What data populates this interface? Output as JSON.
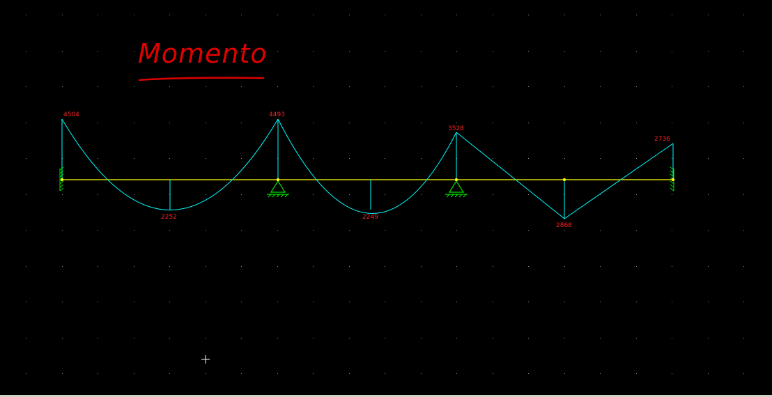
{
  "title": "Momento",
  "colors": {
    "background": "#000000",
    "beam": "#ffff00",
    "diagram": "#00ffff",
    "labels": "#ff2020",
    "title": "#e00000",
    "supports": "#00e000",
    "grid_dots": "#9a9a9a",
    "cursor": "#ffffff"
  },
  "moment_values": {
    "support_1": "4504",
    "span_1_midspan": "2252",
    "support_2": "4493",
    "span_2_midspan": "2249",
    "support_3": "3528",
    "span_3_midspan": "2868",
    "support_4": "2736"
  },
  "icons": {
    "left_support": "fixed-support-icon",
    "pin_support_1": "pin-support-icon",
    "pin_support_2": "pin-support-icon",
    "right_support": "fixed-support-icon",
    "cursor": "crosshair-cursor-icon"
  }
}
